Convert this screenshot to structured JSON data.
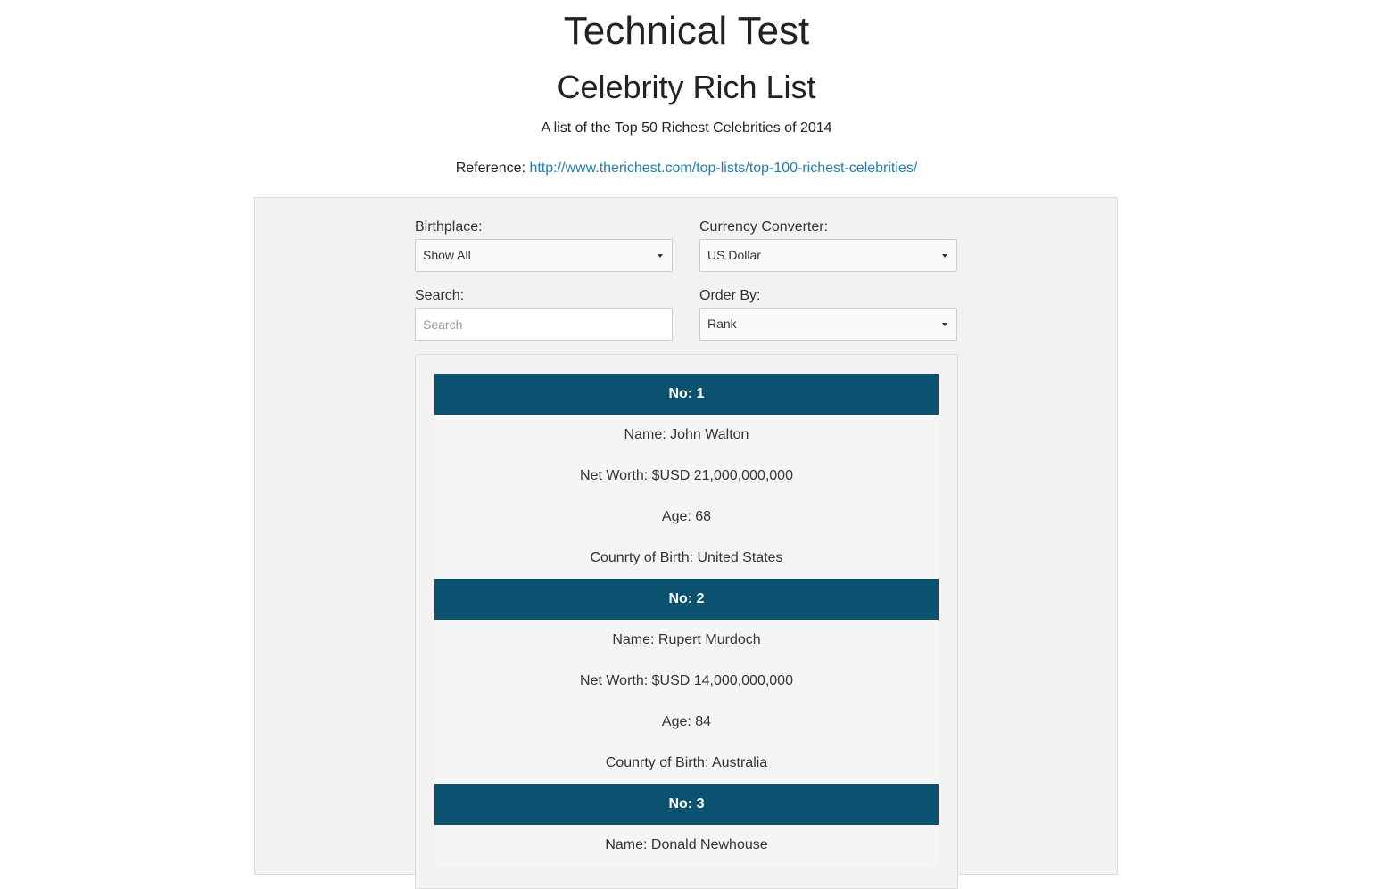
{
  "header": {
    "title": "Technical Test",
    "subtitle": "Celebrity Rich List",
    "description": "A list of the Top 50 Richest Celebrities of 2014",
    "reference_label": "Reference:",
    "reference_url": "http://www.therichest.com/top-lists/top-100-richest-celebrities/"
  },
  "filters": {
    "birthplace_label": "Birthplace:",
    "birthplace_value": "Show All",
    "currency_label": "Currency Converter:",
    "currency_value": "US Dollar",
    "search_label": "Search:",
    "search_placeholder": "Search",
    "search_value": "",
    "order_label": "Order By:",
    "order_value": "Rank"
  },
  "celebrities": [
    {
      "rank": "No: 1",
      "name": "Name: John Walton",
      "net_worth": "Net Worth: $USD 21,000,000,000",
      "age": "Age: 68",
      "country": "Counrty of Birth: United States"
    },
    {
      "rank": "No: 2",
      "name": "Name: Rupert Murdoch",
      "net_worth": "Net Worth: $USD 14,000,000,000",
      "age": "Age: 84",
      "country": "Counrty of Birth: Australia"
    },
    {
      "rank": "No: 3",
      "name": "Name: Donald Newhouse"
    }
  ],
  "colors": {
    "card_header": "#0b5170",
    "link": "#1f7eb5",
    "panel": "#f2f2f2"
  }
}
